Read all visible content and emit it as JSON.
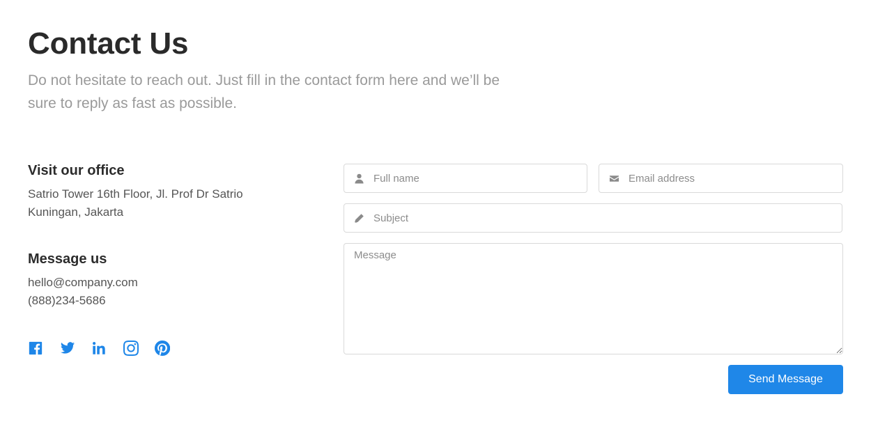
{
  "header": {
    "title": "Contact Us",
    "subtitle": "Do not hesitate to reach out. Just fill in the contact form here and we’ll be sure to reply as fast as possible."
  },
  "office": {
    "heading": "Visit our office",
    "address_line1": "Satrio Tower 16th Floor, Jl. Prof Dr Satrio",
    "address_line2": "Kuningan, Jakarta"
  },
  "message_us": {
    "heading": "Message us",
    "email": "hello@company.com",
    "phone": "(888)234-5686"
  },
  "social": {
    "color": "#1e86e8",
    "icons": [
      "facebook-icon",
      "twitter-icon",
      "linkedin-icon",
      "instagram-icon",
      "pinterest-icon"
    ]
  },
  "form": {
    "full_name": {
      "placeholder": "Full name",
      "value": "",
      "icon": "user-icon"
    },
    "email": {
      "placeholder": "Email address",
      "value": "",
      "icon": "envelope-icon"
    },
    "subject": {
      "placeholder": "Subject",
      "value": "",
      "icon": "pencil-icon"
    },
    "message": {
      "placeholder": "Message",
      "value": ""
    },
    "submit_label": "Send Message",
    "submit_color": "#1f87e8"
  }
}
